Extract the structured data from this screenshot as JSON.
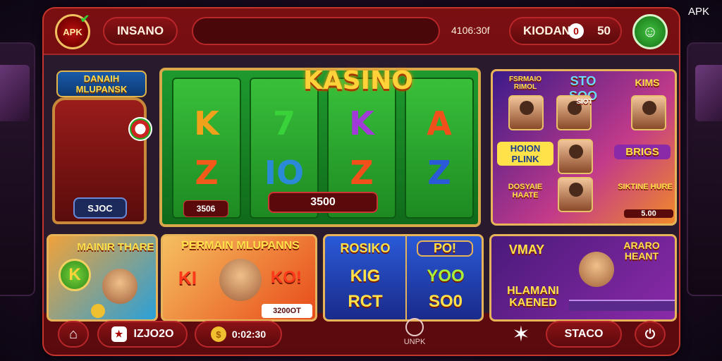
{
  "watermark": "APK",
  "topbar": {
    "logo_text": "APK",
    "username": "INSANO",
    "search_value": "",
    "top_number": "4106:30f",
    "balance_label": "KIODAN",
    "balance_value": "50"
  },
  "throne_card": {
    "title": "DANAIH MLUPANSK",
    "button_label": "SJOC"
  },
  "slot_machine": {
    "title": "KASINO",
    "reels": [
      {
        "top": "K",
        "bottom": "Z",
        "top_color": "#f2a21a",
        "bottom_color": "#f25a1a"
      },
      {
        "top": "7",
        "bottom": "IO",
        "top_color": "#3ad23a",
        "bottom_color": "#2a8ad8"
      },
      {
        "top": "K",
        "bottom": "Z",
        "top_color": "#a23ad8",
        "bottom_color": "#f2501a"
      },
      {
        "top": "A",
        "bottom": "Z",
        "top_color": "#f2501a",
        "bottom_color": "#2a5ad8"
      }
    ],
    "bet_value": "3506",
    "win_value": "3500"
  },
  "promo_panel": {
    "headline_1": "FSRMAIO RIMOL",
    "headline_2": "STO SOO",
    "headline_3": "KIMS",
    "headline_4": "HOION PLINK",
    "headline_5": "BRIGS",
    "headline_6": "DOSYAIE HAATE",
    "headline_7": "SIKTINE HURE",
    "headline_8": "SIOT",
    "footer_value": "5.00"
  },
  "game_cards": [
    {
      "title": "MAINIR THARE",
      "badge": "K"
    },
    {
      "title": "PERMAIN MLUPANNS",
      "left_text": "KI",
      "right_text": "KO!",
      "badge": "3200OT"
    },
    {
      "title_left": "ROSIKO",
      "left_line2": "KIG",
      "left_line3": "RCT",
      "title_right": "PO!",
      "right_line2": "YOO",
      "right_line3": "SO0"
    },
    {
      "title": "VMAY",
      "title_right": "ARARO HEANT",
      "sub": "HLAMANI KAENED"
    }
  ],
  "bottombar": {
    "code_value": "IZJO2O",
    "time_value": "0:02:30",
    "center_label": "UNPK",
    "stack_label": "STACO"
  }
}
